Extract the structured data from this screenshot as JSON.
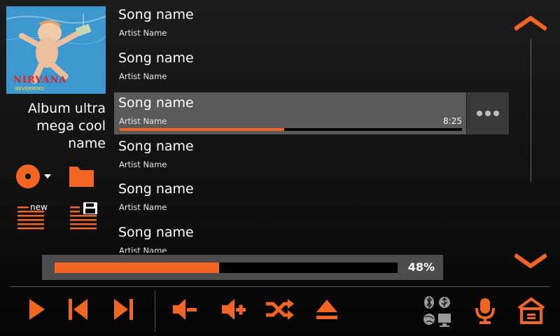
{
  "accent_color": "#f26522",
  "album": {
    "name": "Album ultra mega cool name",
    "art_text": "NIRVANA",
    "art_subtext": "NEVERMIND"
  },
  "left_tools": {
    "disc_icon": "disc-dropdown-icon",
    "folder_icon": "folder-icon",
    "new_playlist_label": "new",
    "save_playlist_icon": "save-playlist-icon"
  },
  "songs": [
    {
      "title": "Song name",
      "artist": "Artist Name"
    },
    {
      "title": "Song name",
      "artist": "Artist Name"
    },
    {
      "title": "Song name",
      "artist": "Artist Name",
      "time": "8:25",
      "progress": 0.48,
      "active": true
    },
    {
      "title": "Song name",
      "artist": "Artist Name"
    },
    {
      "title": "Song name",
      "artist": "Artist Name"
    },
    {
      "title": "Song name",
      "artist": "Artist Name"
    }
  ],
  "playback": {
    "progress_percent": 48,
    "progress_label": "48%"
  },
  "controls": {
    "play": "play-icon",
    "previous": "previous-track-icon",
    "next": "next-track-icon",
    "volume_down": "volume-down-icon",
    "volume_up": "volume-up-icon",
    "shuffle": "shuffle-icon",
    "eject": "eject-icon",
    "connectivity": "connectivity-status-icon",
    "microphone": "microphone-icon",
    "home": "home-icon"
  }
}
